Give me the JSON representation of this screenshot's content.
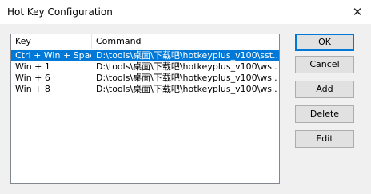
{
  "window": {
    "title": "Hot Key Configuration",
    "close_glyph": "✕"
  },
  "list": {
    "columns": [
      "Key",
      "Command"
    ],
    "rows": [
      {
        "key": "Ctrl + Win + Space",
        "command": "D:\\tools\\桌面\\下载吧\\hotkeyplus_v100\\sst...",
        "selected": true
      },
      {
        "key": "Win + 1",
        "command": "D:\\tools\\桌面\\下载吧\\hotkeyplus_v100\\wsi...",
        "selected": false
      },
      {
        "key": "Win + 6",
        "command": "D:\\tools\\桌面\\下载吧\\hotkeyplus_v100\\wsi...",
        "selected": false
      },
      {
        "key": "Win + 8",
        "command": "D:\\tools\\桌面\\下载吧\\hotkeyplus_v100\\wsi...",
        "selected": false
      }
    ]
  },
  "buttons": {
    "ok": "OK",
    "cancel": "Cancel",
    "add": "Add",
    "delete": "Delete",
    "edit": "Edit"
  },
  "colors": {
    "selection": "#0078d7",
    "accent_border": "#0078d7"
  }
}
